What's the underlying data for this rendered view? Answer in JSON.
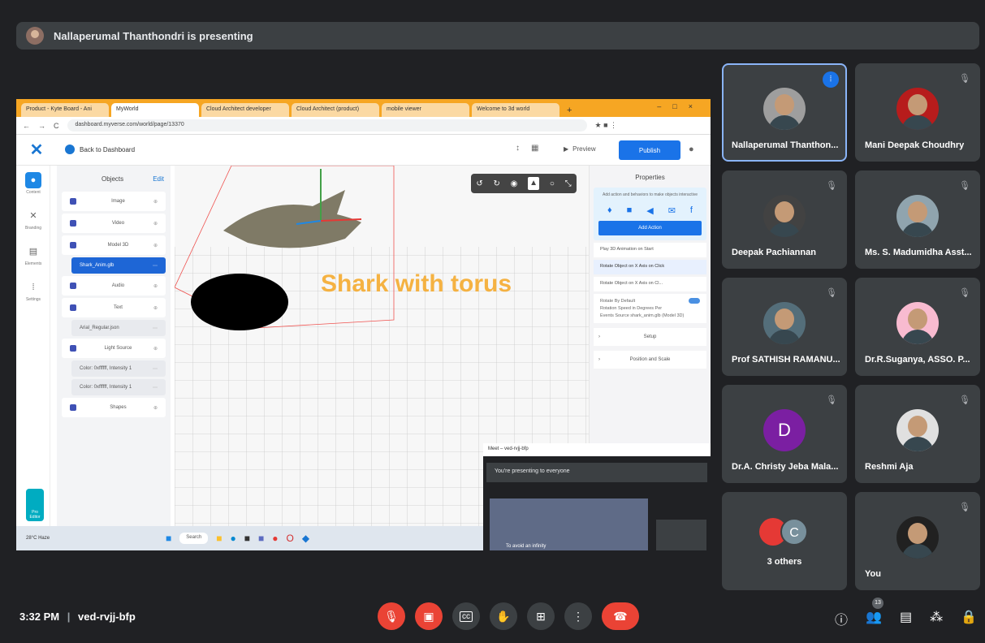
{
  "banner": {
    "text": "Nallaperumal Thanthondri is presenting"
  },
  "screen": {
    "browser_tabs": [
      "Product - Kyte Board - Ani",
      "MyWorld",
      "Cloud Architect developer",
      "Cloud Architect (product)",
      "mobile viewer",
      "Welcome to 3d world"
    ],
    "url": "dashboard.myverse.com/world/page/13370",
    "app": {
      "back_label": "Back to Dashboard",
      "preview_label": "Preview",
      "publish_label": "Publish",
      "nav": [
        "Content",
        "Branding",
        "Elements",
        "Settings"
      ],
      "nav_bottom": "Pro Editor",
      "objects_title": "Objects",
      "objects_edit": "Edit",
      "objects": [
        {
          "label": "Image",
          "kind": "item"
        },
        {
          "label": "Video",
          "kind": "item"
        },
        {
          "label": "Model 3D",
          "kind": "item"
        },
        {
          "label": "Shark_Anim.glb",
          "kind": "selected"
        },
        {
          "label": "Audio",
          "kind": "item"
        },
        {
          "label": "Text",
          "kind": "item"
        },
        {
          "label": "Arial_Regular.json",
          "kind": "sub"
        },
        {
          "label": "Light Source",
          "kind": "item"
        },
        {
          "label": "Color: 0xffffff, Intensity 1",
          "kind": "sub"
        },
        {
          "label": "Color: 0xffffff, Intensity 1",
          "kind": "sub"
        },
        {
          "label": "Shapes",
          "kind": "item"
        }
      ],
      "viewport_text": "Shark with torus",
      "properties": {
        "title": "Properties",
        "hint": "Add action and behaviors to make objects interactive",
        "add_action": "Add Action",
        "rows": [
          "Play 3D Animation on Start",
          "Rotate Object on X Axis on Click",
          "Rotate Object on X Axis on Cl..."
        ],
        "card_lines": [
          "Rotate By Default",
          "Rotation Speed in Degrees Per",
          "Events Source  shark_anim.glb (Model 3D)"
        ],
        "setup": "Setup",
        "position": "Position and Scale"
      }
    },
    "meet_mini": {
      "header": "Meet – ved-rvjj-bfp",
      "presenting": "You're presenting to everyone",
      "thumb_caption": "To avoid an infinity"
    },
    "taskbar": {
      "weather": "28°C Haze",
      "search": "Search"
    }
  },
  "participants": [
    {
      "name": "Nallaperumal Thanthon...",
      "speaking": true,
      "color": "#9e9e9e"
    },
    {
      "name": "Mani Deepak Choudhry",
      "speaking": false,
      "color": "#b71c1c"
    },
    {
      "name": "Deepak Pachiannan",
      "speaking": false,
      "color": "#424242"
    },
    {
      "name": "Ms. S. Madumidha Asst...",
      "speaking": false,
      "color": "#90a4ae"
    },
    {
      "name": "Prof SATHISH RAMANU...",
      "speaking": false,
      "color": "#546e7a"
    },
    {
      "name": "Dr.R.Suganya, ASSO. P...",
      "speaking": false,
      "color": "#f8bbd0"
    },
    {
      "name": "Dr.A. Christy Jeba Mala...",
      "speaking": false,
      "letter": "D"
    },
    {
      "name": "Reshmi Aja",
      "speaking": false,
      "color": "#e0e0e0"
    },
    {
      "name": "3 others",
      "others": true,
      "letter": "C"
    },
    {
      "name": "You",
      "speaking": false,
      "color": "#212121"
    }
  ],
  "bottom": {
    "time": "3:32 PM",
    "separator": "|",
    "meeting_code": "ved-rvjj-bfp",
    "participant_count": "13"
  }
}
